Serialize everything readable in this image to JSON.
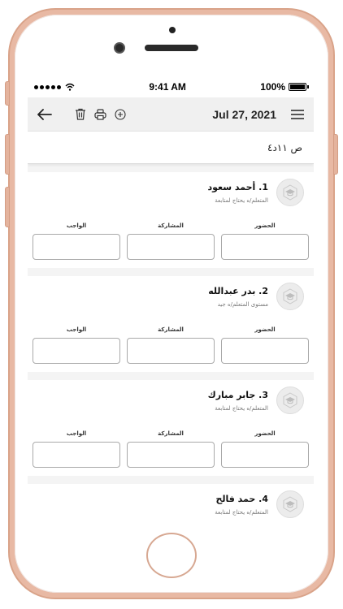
{
  "status": {
    "time": "9:41 AM",
    "battery": "100%"
  },
  "toolbar": {
    "date": "Jul 27, 2021"
  },
  "class_label": "ص ١١د٤",
  "students": [
    {
      "name": "1. أحمد سعود",
      "note": "المتعلم/ه يحتاج لمتابعة"
    },
    {
      "name": "2. بدر عبدالله",
      "note": "مستوى المتعلم/ه جيد"
    },
    {
      "name": "3. جابر مبارك",
      "note": "المتعلم/ه يحتاج لمتابعة"
    },
    {
      "name": "4. حمد فالح",
      "note": "المتعلم/ه يحتاج لمتابعة"
    }
  ],
  "fields": {
    "attendance": "الحضور",
    "participation": "المشاركة",
    "homework": "الواجب"
  }
}
